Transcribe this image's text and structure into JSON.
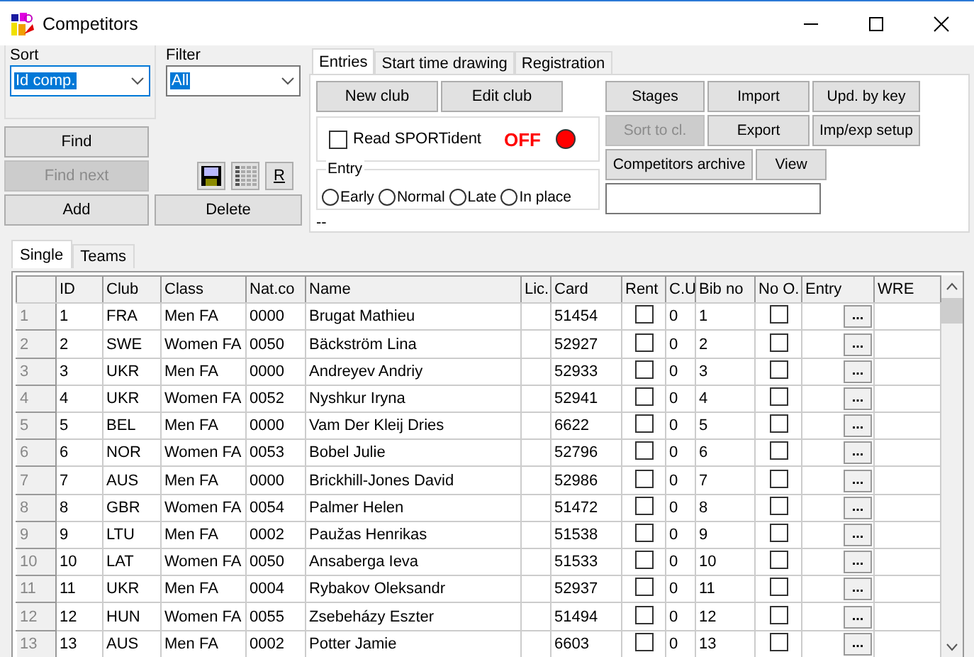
{
  "window": {
    "title": "Competitors"
  },
  "sort": {
    "label": "Sort",
    "value": "Id comp."
  },
  "filter": {
    "label": "Filter",
    "value": "All"
  },
  "left_buttons": [
    {
      "label": "Find",
      "disabled": false
    },
    {
      "label": "Find next",
      "disabled": true
    },
    {
      "label": "Add",
      "disabled": false
    },
    {
      "label": "Delete",
      "disabled": false
    }
  ],
  "tool_buttons": [
    {
      "kind": "save"
    },
    {
      "kind": "grid"
    },
    {
      "kind": "text",
      "label": "R"
    }
  ],
  "tabs": [
    {
      "label": "Entries",
      "selected": true
    },
    {
      "label": "Start time drawing",
      "selected": false
    },
    {
      "label": "Registration",
      "selected": false
    }
  ],
  "club_buttons": [
    {
      "label": "New club",
      "disabled": false
    },
    {
      "label": "Edit club",
      "disabled": false
    }
  ],
  "read_sportident": {
    "label": "Read SPORTident",
    "checked": false,
    "status": "OFF",
    "color": "#ff0000"
  },
  "entry": {
    "label": "Entry",
    "options": [
      {
        "label": "Early",
        "selected": false
      },
      {
        "label": "Normal",
        "selected": false
      },
      {
        "label": "Late",
        "selected": false
      },
      {
        "label": "In place",
        "selected": false
      }
    ]
  },
  "status_text": "--",
  "action_buttons": [
    {
      "label": "Stages",
      "disabled": false
    },
    {
      "label": "Import",
      "disabled": false
    },
    {
      "label": "Upd. by key",
      "disabled": false
    },
    {
      "label": "Sort to cl.",
      "disabled": true
    },
    {
      "label": "Export",
      "disabled": false
    },
    {
      "label": "Imp/exp setup",
      "disabled": false
    }
  ],
  "archive_buttons": [
    {
      "label": "Competitors archive",
      "disabled": false
    },
    {
      "label": "View",
      "disabled": false
    }
  ],
  "list_tabs": [
    {
      "label": "Single",
      "selected": true
    },
    {
      "label": "Teams",
      "selected": false
    }
  ],
  "table": {
    "columns": [
      "ID",
      "Club",
      "Class",
      "Nat.co",
      "Name",
      "Lic.",
      "Card",
      "Rent",
      "C.U",
      "Bib no",
      "No O.",
      "Entry",
      "WRE"
    ],
    "rows": [
      {
        "row": "1",
        "id": "1",
        "club": "FRA",
        "class": "Men FA",
        "nat_code": "0000",
        "name": "Brugat Mathieu",
        "card": "51454",
        "rent": false,
        "cu": "0",
        "bib": "1",
        "no_o": false,
        "entry": "..."
      },
      {
        "row": "2",
        "id": "2",
        "club": "SWE",
        "class": "Women FA",
        "nat_code": "0050",
        "name": "Bäckström Lina",
        "card": "52927",
        "rent": false,
        "cu": "0",
        "bib": "2",
        "no_o": false,
        "entry": "..."
      },
      {
        "row": "3",
        "id": "3",
        "club": "UKR",
        "class": "Men FA",
        "nat_code": "0000",
        "name": "Andreyev Andriy",
        "card": "52933",
        "rent": false,
        "cu": "0",
        "bib": "3",
        "no_o": false,
        "entry": "..."
      },
      {
        "row": "4",
        "id": "4",
        "club": "UKR",
        "class": "Women FA",
        "nat_code": "0052",
        "name": "Nyshkur Iryna",
        "card": "52941",
        "rent": false,
        "cu": "0",
        "bib": "4",
        "no_o": false,
        "entry": "..."
      },
      {
        "row": "5",
        "id": "5",
        "club": "BEL",
        "class": "Men FA",
        "nat_code": "0000",
        "name": "Vam Der Kleij Dries",
        "card": "6622",
        "rent": false,
        "cu": "0",
        "bib": "5",
        "no_o": false,
        "entry": "..."
      },
      {
        "row": "6",
        "id": "6",
        "club": "NOR",
        "class": "Women FA",
        "nat_code": "0053",
        "name": "Bobel Julie",
        "card": "52796",
        "rent": false,
        "cu": "0",
        "bib": "6",
        "no_o": false,
        "entry": "..."
      },
      {
        "row": "7",
        "id": "7",
        "club": "AUS",
        "class": "Men FA",
        "nat_code": "0000",
        "name": "Brickhill-Jones David",
        "card": "52986",
        "rent": false,
        "cu": "0",
        "bib": "7",
        "no_o": false,
        "entry": "..."
      },
      {
        "row": "8",
        "id": "8",
        "club": "GBR",
        "class": "Women FA",
        "nat_code": "0054",
        "name": "Palmer Helen",
        "card": "51472",
        "rent": false,
        "cu": "0",
        "bib": "8",
        "no_o": false,
        "entry": "..."
      },
      {
        "row": "9",
        "id": "9",
        "club": "LTU",
        "class": "Men FA",
        "nat_code": "0002",
        "name": "Paužas Henrikas",
        "card": "51538",
        "rent": false,
        "cu": "0",
        "bib": "9",
        "no_o": false,
        "entry": "..."
      },
      {
        "row": "10",
        "id": "10",
        "club": "LAT",
        "class": "Women FA",
        "nat_code": "0050",
        "name": "Ansaberga Ieva",
        "card": "51533",
        "rent": false,
        "cu": "0",
        "bib": "10",
        "no_o": false,
        "entry": "..."
      },
      {
        "row": "11",
        "id": "11",
        "club": "UKR",
        "class": "Men FA",
        "nat_code": "0004",
        "name": "Rybakov Oleksandr",
        "card": "52937",
        "rent": false,
        "cu": "0",
        "bib": "11",
        "no_o": false,
        "entry": "..."
      },
      {
        "row": "12",
        "id": "12",
        "club": "HUN",
        "class": "Women FA",
        "nat_code": "0055",
        "name": "Zsebeházy Eszter",
        "card": "51494",
        "rent": false,
        "cu": "0",
        "bib": "12",
        "no_o": false,
        "entry": "..."
      },
      {
        "row": "13",
        "id": "13",
        "club": "AUS",
        "class": "Men FA",
        "nat_code": "0002",
        "name": "Potter Jamie",
        "card": "6603",
        "rent": false,
        "cu": "0",
        "bib": "13",
        "no_o": false,
        "entry": "..."
      }
    ]
  }
}
